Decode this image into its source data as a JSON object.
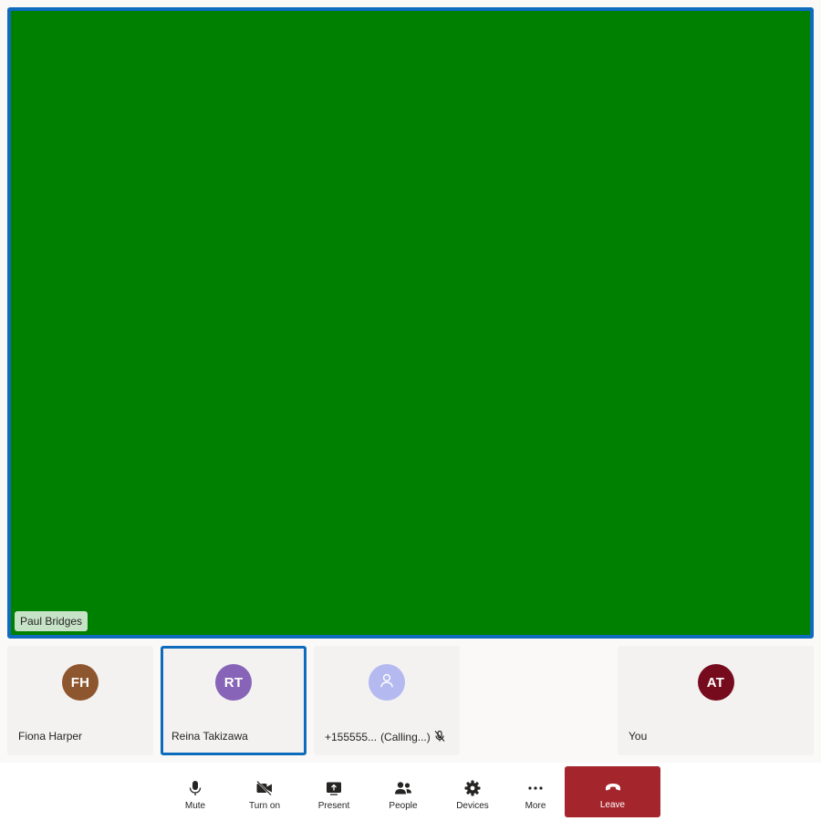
{
  "stage": {
    "participant_name": "Paul Bridges",
    "video_color": "#008000"
  },
  "tiles": [
    {
      "initials": "FH",
      "name": "Fiona Harper",
      "avatar_color": "#8e562e",
      "active": false
    },
    {
      "initials": "RT",
      "name": "Reina Takizawa",
      "avatar_color": "#8764b8",
      "active": true
    },
    {
      "initials": "",
      "name": "+155555...",
      "status": "(Calling...)",
      "avatar_color": "#b4b9f0",
      "icon": "person-icon",
      "muted": true
    },
    {
      "initials": "AT",
      "name": "You",
      "avatar_color": "#750b1c",
      "active": false
    }
  ],
  "controls": {
    "mute": {
      "label": "Mute",
      "icon": "microphone-icon"
    },
    "camera": {
      "label": "Turn on",
      "icon": "camera-off-icon"
    },
    "present": {
      "label": "Present",
      "icon": "share-screen-icon"
    },
    "people": {
      "label": "People",
      "icon": "people-icon"
    },
    "devices": {
      "label": "Devices",
      "icon": "gear-icon"
    },
    "more": {
      "label": "More",
      "icon": "more-dots-icon"
    },
    "leave": {
      "label": "Leave",
      "icon": "hang-up-icon",
      "color": "#a4262c"
    }
  }
}
